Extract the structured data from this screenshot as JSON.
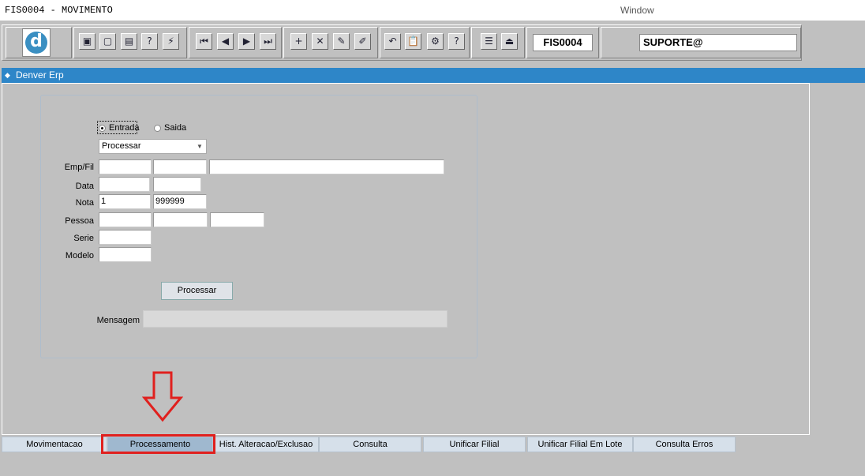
{
  "titlebar": {
    "title": "FIS0004 - MOVIMENTO",
    "window_menu": "Window"
  },
  "toolbar": {
    "logo_letter": "d",
    "buttons": [
      {
        "icon": "save-icon",
        "glyph": "▣"
      },
      {
        "icon": "window-icon",
        "glyph": "▢"
      },
      {
        "icon": "print-icon",
        "glyph": "▤"
      },
      {
        "icon": "query-icon",
        "glyph": "?"
      },
      {
        "icon": "execute-query-icon",
        "glyph": "⚡"
      },
      {
        "icon": "first-record-icon",
        "glyph": "⏮"
      },
      {
        "icon": "previous-record-icon",
        "glyph": "◀"
      },
      {
        "icon": "next-record-icon",
        "glyph": "▶"
      },
      {
        "icon": "last-record-icon",
        "glyph": "⏭"
      },
      {
        "icon": "insert-record-icon",
        "glyph": "+"
      },
      {
        "icon": "delete-record-icon",
        "glyph": "✕"
      },
      {
        "icon": "edit-icon",
        "glyph": "✎"
      },
      {
        "icon": "clear-icon",
        "glyph": "✐"
      },
      {
        "icon": "undo-icon",
        "glyph": "↶"
      },
      {
        "icon": "clipboard-icon",
        "glyph": "📋"
      },
      {
        "icon": "tools-icon",
        "glyph": "⚙"
      },
      {
        "icon": "help-icon",
        "glyph": "?"
      },
      {
        "icon": "menu-icon",
        "glyph": "☰"
      },
      {
        "icon": "exit-icon",
        "glyph": "⏏"
      }
    ],
    "form_code": "FIS0004",
    "user": "SUPORTE@"
  },
  "denver_bar": {
    "title": "Denver Erp"
  },
  "form": {
    "radio_entrada": "Entrada",
    "radio_saida": "Saida",
    "select_value": "Processar",
    "labels": {
      "emp_fil": "Emp/Fil",
      "data": "Data",
      "nota": "Nota",
      "pessoa": "Pessoa",
      "serie": "Serie",
      "modelo": "Modelo",
      "mensagem": "Mensagem"
    },
    "values": {
      "nota_inicio": "1",
      "nota_fim": "999999"
    },
    "process_button": "Processar"
  },
  "tabs": [
    {
      "label": "Movimentacao"
    },
    {
      "label": "Processamento"
    },
    {
      "label": "Hist. Alteracao/Exclusao"
    },
    {
      "label": "Consulta"
    },
    {
      "label": "Unificar Filial"
    },
    {
      "label": "Unificar Filial Em Lote"
    },
    {
      "label": "Consulta Erros"
    }
  ],
  "colors": {
    "accent_bar": "#2e86c8",
    "annotation": "#e0201e"
  }
}
